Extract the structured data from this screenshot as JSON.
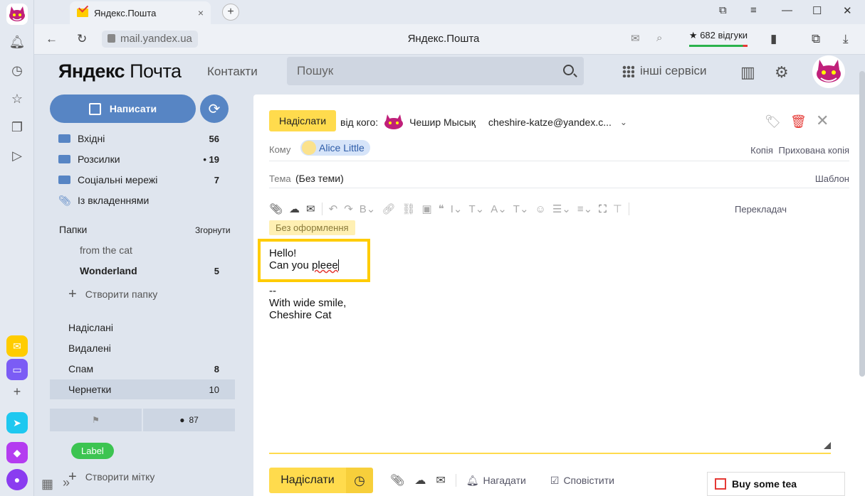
{
  "browser": {
    "tab_title": "Яндекс.Пошта",
    "tab_close": "×",
    "new_tab": "+",
    "url": "mail.yandex.ua",
    "page_title": "Яндекс.Пошта",
    "reviews": "★ 682 відгуки",
    "window_controls": [
      "⧉",
      "≡",
      "—",
      "☐",
      "✕"
    ]
  },
  "header": {
    "logo_brand": "Яндекс",
    "logo_product": "Почта",
    "contacts": "Контакти",
    "search_placeholder": "Пошук",
    "services": "інші сервіси"
  },
  "sidebar": {
    "compose": "Написати",
    "folders": [
      {
        "label": "Вхідні",
        "count": "56"
      },
      {
        "label": "Розсилки",
        "count": "• 19"
      },
      {
        "label": "Соціальні мережі",
        "count": "7"
      },
      {
        "label": "Із вкладеннями",
        "count": ""
      }
    ],
    "folders_title": "Папки",
    "collapse": "Згорнути",
    "custom": [
      {
        "label": "from the cat",
        "count": ""
      },
      {
        "label": "Wonderland",
        "count": "5"
      }
    ],
    "create_folder": "Створити папку",
    "system": [
      {
        "label": "Надіслані",
        "count": ""
      },
      {
        "label": "Видалені",
        "count": ""
      },
      {
        "label": "Спам",
        "count": "8"
      },
      {
        "label": "Чернетки",
        "count": "10"
      }
    ],
    "important_count": "87",
    "label": "Label",
    "create_label": "Створити мітку"
  },
  "compose": {
    "send": "Надіслати",
    "from_label": "від кого:",
    "from_name": "Чешир Мысық",
    "from_email": "cheshire-katze@yandex.c...",
    "to_label": "Кому",
    "recipient": "Alice Little",
    "cc": "Копія",
    "bcc": "Прихована копія",
    "subject_label": "Тема",
    "subject": "(Без теми)",
    "template": "Шаблон",
    "translate": "Перекладач",
    "no_format": "Без оформлення",
    "body_line1": "Hello!",
    "body_line2_a": "Can you ",
    "body_line2_typo": "pleee",
    "signature": [
      "--",
      "With wide smile,",
      "Cheshire Cat"
    ],
    "remind": "Нагадати",
    "notify": "Сповістити"
  },
  "todo": "Buy some tea",
  "colors": {
    "accent": "#5785c4",
    "send_yellow": "#ffdb4d",
    "highlight": "#ffcc00",
    "label_green": "#3cc451"
  }
}
